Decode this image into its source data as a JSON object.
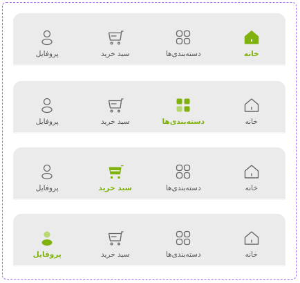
{
  "colors": {
    "active": "#7fb20d",
    "active_light": "#b7d86f",
    "inactive": "#666666",
    "bar": "#ebebeb",
    "frame": "#9b6cf0"
  },
  "tabs": [
    {
      "key": "home",
      "label": "خانه",
      "icon": "home-icon"
    },
    {
      "key": "categories",
      "label": "دسته‌بندی‌ها",
      "icon": "grid-icon"
    },
    {
      "key": "cart",
      "label": "سبد خرید",
      "icon": "cart-icon"
    },
    {
      "key": "profile",
      "label": "پروفایل",
      "icon": "user-icon"
    }
  ],
  "navbars": [
    {
      "active": "home"
    },
    {
      "active": "categories"
    },
    {
      "active": "cart"
    },
    {
      "active": "profile"
    }
  ]
}
